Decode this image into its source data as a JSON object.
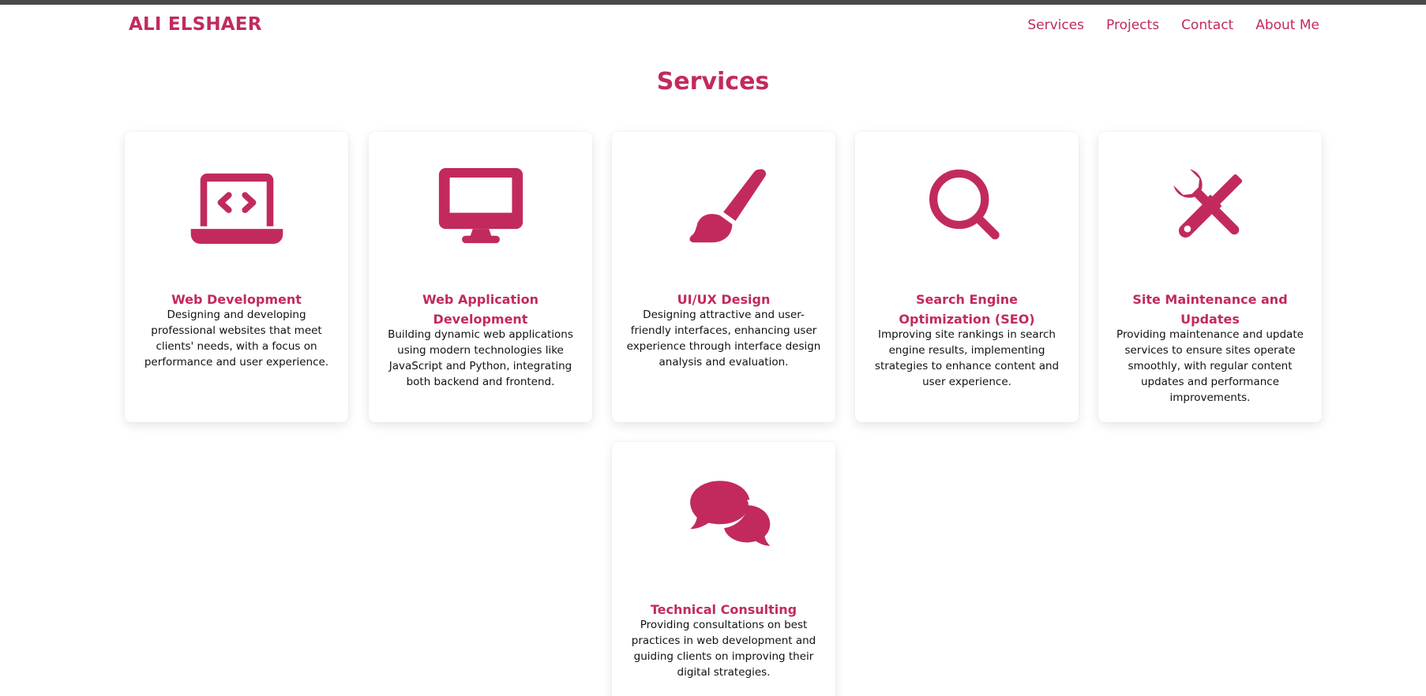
{
  "colors": {
    "accent": "#c22a5d",
    "top_strip": "#4a4a4a",
    "text": "#111111"
  },
  "header": {
    "brand": "ALI ELSHAER"
  },
  "nav": {
    "items": [
      {
        "label": "Services"
      },
      {
        "label": "Projects"
      },
      {
        "label": "Contact"
      },
      {
        "label": "About Me"
      }
    ]
  },
  "services": {
    "title": "Services",
    "cards": [
      {
        "icon": "laptop-code-icon",
        "title": "Web Development",
        "description": "Designing and developing professional websites that meet clients' needs, with a focus on performance and user experience."
      },
      {
        "icon": "desktop-icon",
        "title": "Web Application Development",
        "description": "Building dynamic web applications using modern technologies like JavaScript and Python, integrating both backend and frontend."
      },
      {
        "icon": "paintbrush-icon",
        "title": "UI/UX Design",
        "description": "Designing attractive and user-friendly interfaces, enhancing user experience through interface design analysis and evaluation."
      },
      {
        "icon": "search-icon",
        "title": "Search Engine Optimization (SEO)",
        "description": "Improving site rankings in search engine results, implementing strategies to enhance content and user experience."
      },
      {
        "icon": "tools-icon",
        "title": "Site Maintenance and Updates",
        "description": "Providing maintenance and update services to ensure sites operate smoothly, with regular content updates and performance improvements."
      },
      {
        "icon": "comments-icon",
        "title": "Technical Consulting",
        "description": "Providing consultations on best practices in web development and guiding clients on improving their digital strategies."
      }
    ]
  }
}
